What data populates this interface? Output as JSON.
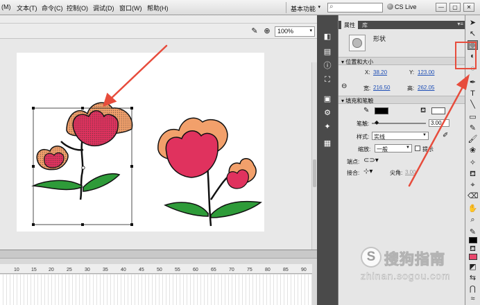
{
  "menu": [
    "(M)",
    "文本(T)",
    "命令(C)",
    "控制(O)",
    "调试(D)",
    "窗口(W)",
    "帮助(H)"
  ],
  "workspace": {
    "label": "基本功能",
    "caret": "▾"
  },
  "search": {
    "placeholder": "",
    "icon": "magnifier-icon"
  },
  "cs_live": "CS Live",
  "window_controls": [
    "—",
    "▢",
    "✕"
  ],
  "stage": {
    "zoom": "100%",
    "zoom_caret": "▾"
  },
  "timeline": {
    "ruler_numbers": [
      "10",
      "15",
      "20",
      "25",
      "30",
      "35",
      "40",
      "45",
      "50",
      "55",
      "60",
      "65",
      "70",
      "75",
      "80",
      "85",
      "90"
    ]
  },
  "properties": {
    "tabs": [
      "属性",
      "库"
    ],
    "panel_menu": "▾≡",
    "object_type": "形状",
    "position_size": {
      "header": "位置和大小",
      "x_label": "X:",
      "x_value": "38.20",
      "y_label": "Y:",
      "y_value": "123.00",
      "w_label": "宽:",
      "w_value": "216.50",
      "h_label": "高:",
      "h_value": "262.05"
    },
    "fill_stroke": {
      "header": "填充和笔触",
      "stroke_color": "#000000",
      "fill_color": "#ffffff",
      "stroke_label": "笔触:",
      "stroke_value": "3.00",
      "style_label": "样式:",
      "style_value": "实线",
      "scale_label": "缩放:",
      "scale_value": "一般",
      "hint_label": "提示",
      "cap_label": "端点:",
      "join_label": "接合:",
      "miter_label": "尖角:",
      "miter_value": "3.00"
    }
  },
  "tools": {
    "fill_color": "#e8476b",
    "stroke_color": "#000000"
  },
  "watermark": {
    "logo": "S",
    "name": "搜狗指南",
    "url": "zhinan.sogou.com"
  },
  "colors": {
    "accent_red": "#e74c3c",
    "petal_pink": "#e0325e",
    "petal_orange": "#f2a06b",
    "leaf_green": "#2e9b39"
  }
}
